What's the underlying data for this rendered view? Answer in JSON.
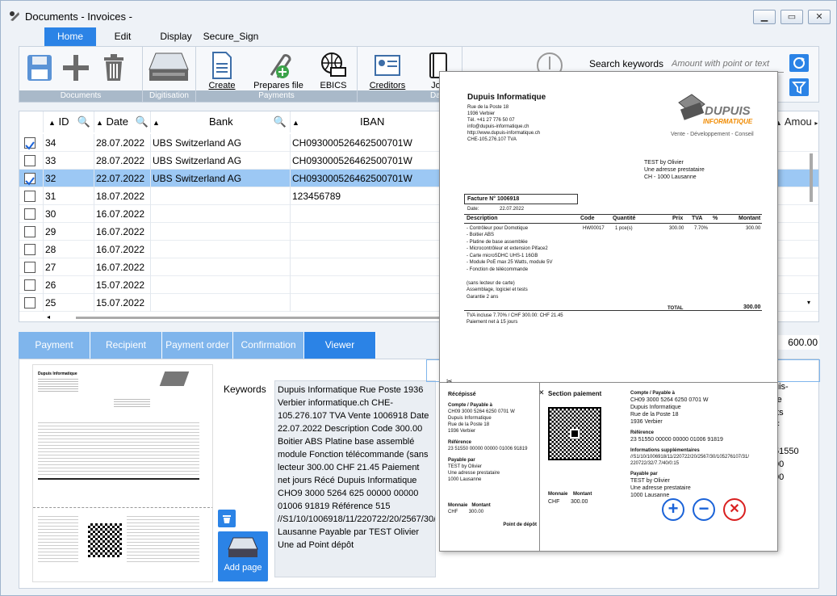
{
  "window": {
    "title": "Documents - Invoices -"
  },
  "tabs": [
    "Home",
    "Edit",
    "Display",
    "Secure_Sign"
  ],
  "ribbon": {
    "groups": [
      "Documents",
      "Digitisation",
      "Payments",
      "Da"
    ],
    "buttons": [
      "Create",
      "Prepares file",
      "EBICS",
      "Creditors",
      "Jou"
    ],
    "search_label": "Search keywords",
    "search_placeholder": "Amount with point or text"
  },
  "grid": {
    "headers": [
      "ID",
      "Date",
      "Bank",
      "IBAN",
      "Amou"
    ],
    "rows": [
      {
        "checked": true,
        "id": "34",
        "date": "28.07.2022",
        "bank": "UBS Switzerland AG",
        "iban": "CH093000526462500701W",
        "selected": false
      },
      {
        "checked": false,
        "id": "33",
        "date": "28.07.2022",
        "bank": "UBS Switzerland AG",
        "iban": "CH093000526462500701W",
        "selected": false
      },
      {
        "checked": true,
        "id": "32",
        "date": "22.07.2022",
        "bank": "UBS Switzerland AG",
        "iban": "CH093000526462500701W",
        "selected": true
      },
      {
        "checked": false,
        "id": "31",
        "date": "18.07.2022",
        "bank": "",
        "iban": "123456789",
        "selected": false
      },
      {
        "checked": false,
        "id": "30",
        "date": "16.07.2022",
        "bank": "",
        "iban": "",
        "selected": false
      },
      {
        "checked": false,
        "id": "29",
        "date": "16.07.2022",
        "bank": "",
        "iban": "",
        "selected": false
      },
      {
        "checked": false,
        "id": "28",
        "date": "16.07.2022",
        "bank": "",
        "iban": "",
        "selected": false
      },
      {
        "checked": false,
        "id": "27",
        "date": "16.07.2022",
        "bank": "",
        "iban": "",
        "selected": false
      },
      {
        "checked": false,
        "id": "26",
        "date": "15.07.2022",
        "bank": "",
        "iban": "",
        "selected": false
      },
      {
        "checked": false,
        "id": "25",
        "date": "15.07.2022",
        "bank": "",
        "iban": "",
        "selected": false
      }
    ],
    "total": "600.00"
  },
  "bottom_tabs": [
    "Payment",
    "Recipient",
    "Payment order",
    "Confirmation",
    "Viewer"
  ],
  "viewer_panel": {
    "keywords_label": "Keywords",
    "keywords_text": "Dupuis Informatique Rue Poste 1936 Verbier informatique.ch CHE-105.276.107 TVA Vente 1006918 Date 22.07.2022 Description Code 300.00 Boitier ABS Platine base assemblé module Fonction télécommande (sans lecteur 300.00 CHF 21.45 Paiement net jours Récé Dupuis Informatique CHO9 3000 5264 625 00000 00000 01006 91819 Référence 515 //S1/10/1006918/11/220722/20/2567/30/1 Lausanne Payable par TEST Olivier Une ad Point dépôt",
    "right_fragments": [
      "uis-",
      "re",
      "tts",
      "F",
      "51550",
      "00",
      "00"
    ],
    "add_page": "Add page"
  },
  "invoice": {
    "company": "Dupuis Informatique",
    "address": [
      "Rue de la Poste 18",
      "1936 Verbier",
      "Tél. +41 27 776 50 07",
      "info@dupuis-informatique.ch",
      "http://www.dupuis-informatique.ch",
      "CHE-105.276.107 TVA"
    ],
    "logo_top": "DUPUIS",
    "logo_bottom": "INFORMATIQUE",
    "tagline": "Vente - Développement - Conseil",
    "recipient": [
      "TEST by Olivier",
      "Une adresse prestataire",
      "CH - 1000 Lausanne"
    ],
    "invoice_no": "Facture N° 1006918",
    "date_label": "Date:",
    "date": "22.07.2022",
    "table_headers": [
      "Description",
      "Code",
      "Quantité",
      "Prix",
      "TVA",
      "%",
      "Montant"
    ],
    "line": {
      "desc": "- Contrôleur pour Domotique",
      "code": "HW00017",
      "qty": "1 pce(s)",
      "price": "300.00",
      "tva": "7.70%",
      "amount": "300.00"
    },
    "details": [
      "- Boitier ABS",
      "- Platine de base assemblée",
      "- Microcontrôleur et extension Piface2",
      "- Carte microSDHC UHS-1 16GB",
      "- Module PoE max 25 Watts, module 5V",
      "- Fonction de télécommande",
      "",
      "(sans lecteur de carte)",
      "Assemblage, logiciel et tests",
      "Garantie 2 ans"
    ],
    "total_label": "TOTAL",
    "total": "300.00",
    "vat": "TVA incluse 7.70% / CHF 300.00: CHF 21.45",
    "payment": "Paiement net à 15 jours",
    "receipt": {
      "title": "Récépissé",
      "account_label": "Compte / Payable à",
      "account": [
        "CH09 3000 5264 6250 0701 W",
        "Dupuis Informatique",
        "Rue de la Poste 18",
        "1936 Verbier"
      ],
      "ref_label": "Référence",
      "ref": "23 51550 00000 00000 01006 91819",
      "payer_label": "Payable par",
      "payer": [
        "TEST by Olivier",
        "Une adresse prestataire",
        "1000 Lausanne"
      ],
      "currency_label": "Monnaie",
      "currency": "CHF",
      "amount_label": "Montant",
      "amount": "300.00",
      "deposit": "Point de dépôt"
    },
    "payment_section": {
      "title": "Section paiement",
      "info_label": "Informations supplémentaires",
      "info": [
        "//S1/10/1006918/11/220722/20/2567/30/105276107/31/",
        "220722/32/7.7/40/0:15"
      ]
    }
  }
}
